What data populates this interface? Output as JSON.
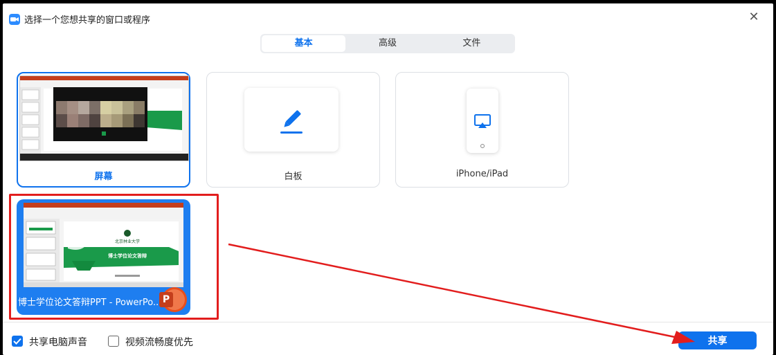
{
  "window": {
    "title": "选择一个您想共享的窗口或程序",
    "close_glyph": "✕"
  },
  "tabs": [
    {
      "label": "基本",
      "active": true
    },
    {
      "label": "高级",
      "active": false
    },
    {
      "label": "文件",
      "active": false
    }
  ],
  "options": {
    "screen": {
      "label": "屏幕",
      "selected": true
    },
    "whiteboard": {
      "label": "白板"
    },
    "iphone": {
      "label": "iPhone/iPad"
    }
  },
  "windows": [
    {
      "label": "博士学位论文答辩PPT - PowerPo...",
      "app_badge": "P"
    }
  ],
  "thumbnail_text": {
    "university": "北京林业大学",
    "slide_title": "博士学位论文答辩"
  },
  "footer": {
    "share_audio": {
      "label": "共享电脑声音",
      "checked": true
    },
    "optimize_video": {
      "label": "视频流畅度优先",
      "checked": false
    },
    "share_button": "共享"
  },
  "colors": {
    "accent": "#0e72ed",
    "annotation_red": "#e21d1d",
    "slide_green": "#1a9a4a"
  }
}
